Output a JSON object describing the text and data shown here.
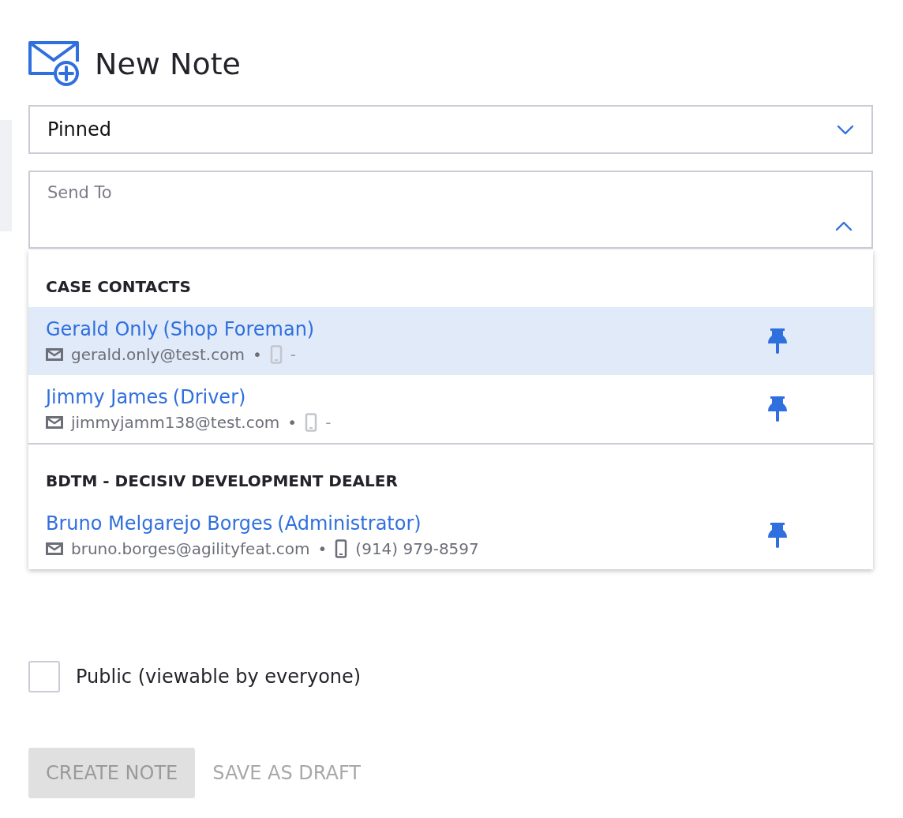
{
  "header": {
    "title": "New Note"
  },
  "type_select": {
    "value": "Pinned",
    "expanded": false
  },
  "send_to": {
    "label": "Send To",
    "expanded": true,
    "groups": [
      {
        "heading": "CASE CONTACTS",
        "contacts": [
          {
            "name": "Gerald Only",
            "role": "(Shop Foreman)",
            "email": "gerald.only@test.com",
            "separator": "•",
            "phone": "-",
            "phone_available": false,
            "selected": true
          },
          {
            "name": "Jimmy James",
            "role": "(Driver)",
            "email": "jimmyjamm138@test.com",
            "separator": "•",
            "phone": "-",
            "phone_available": false,
            "selected": false
          }
        ]
      },
      {
        "heading": "BDTM - DECISIV DEVELOPMENT DEALER",
        "contacts": [
          {
            "name": "Bruno Melgarejo Borges",
            "role": "(Administrator)",
            "email": "bruno.borges@agilityfeat.com",
            "separator": "•",
            "phone": "(914) 979-8597",
            "phone_available": true,
            "selected": false
          }
        ]
      }
    ]
  },
  "public_checkbox": {
    "label": "Public (viewable by everyone)",
    "checked": false
  },
  "buttons": [
    {
      "label": "CREATE NOTE",
      "kind": "filled",
      "disabled": true
    },
    {
      "label": "SAVE AS DRAFT",
      "kind": "text",
      "disabled": true
    }
  ]
}
